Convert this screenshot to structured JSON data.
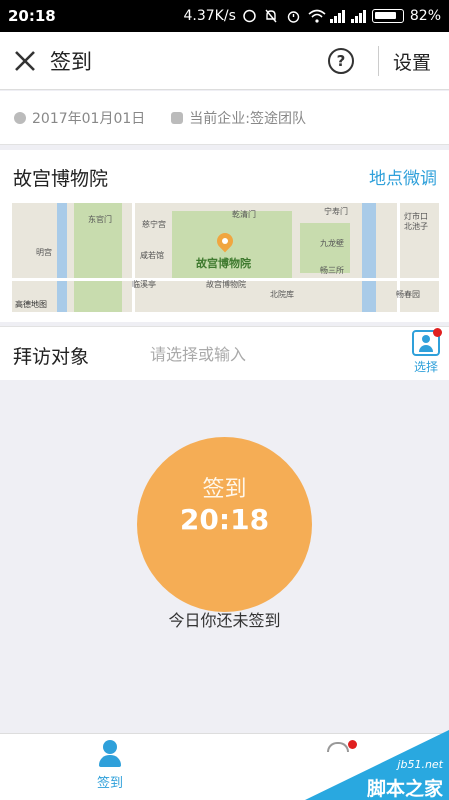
{
  "status_bar": {
    "time": "20:18",
    "speed": "4.37K/s",
    "battery": "82%"
  },
  "header": {
    "title": "签到",
    "help_label": "?",
    "settings_label": "设置"
  },
  "info": {
    "date": "2017年01月01日",
    "company": "当前企业:签途团队"
  },
  "location": {
    "name": "故宫博物院",
    "adjust_label": "地点微调",
    "map": {
      "main_label": "故宫博物院",
      "labels": [
        "东官门",
        "乾清门",
        "宁寿门",
        "慈宁宫",
        "九龙壁",
        "咸若馆",
        "畅三所",
        "临溪亭",
        "故宫博物院",
        "北院库",
        "灯市口",
        "北池子",
        "明宫",
        "畅春园"
      ],
      "logo": "高德地图"
    }
  },
  "visit": {
    "label": "拜访对象",
    "placeholder": "请选择或输入",
    "value": "",
    "choose_label": "选择"
  },
  "sign_in": {
    "label": "签到",
    "time": "20:18",
    "status": "今日你还未签到"
  },
  "bottom_nav": {
    "signin_label": "签到"
  },
  "watermark": {
    "domain": "jb51.net",
    "name": "脚本之家"
  },
  "colors": {
    "accent": "#2fa0da",
    "circle": "#f5ad55",
    "badge": "#e02020"
  }
}
